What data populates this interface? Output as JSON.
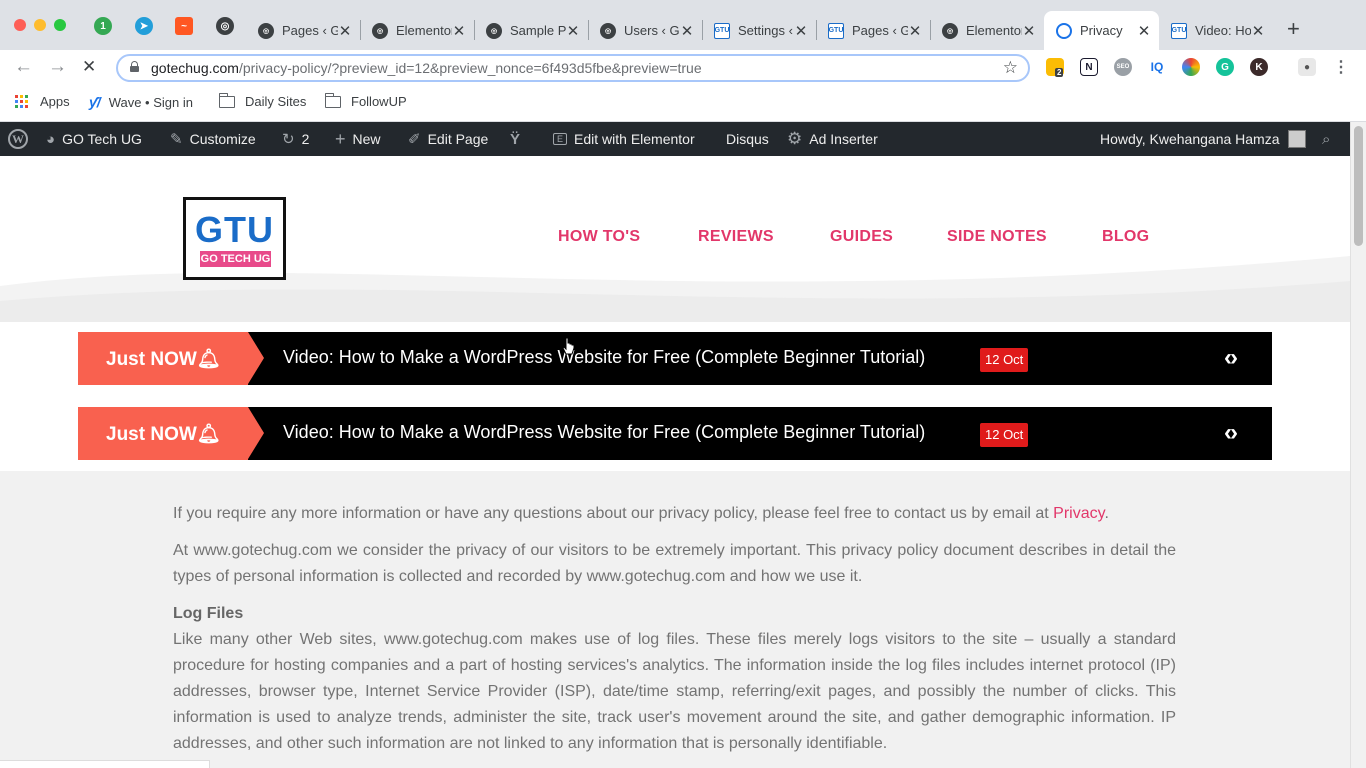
{
  "browser": {
    "tabs": [
      {
        "title": "Pages ‹ GO Tech UG — WordPress",
        "favicon": "globe-icon"
      },
      {
        "title": "Elementor",
        "favicon": "globe-icon"
      },
      {
        "title": "Sample Page",
        "favicon": "globe-icon"
      },
      {
        "title": "Users ‹ GO Tech UG",
        "favicon": "globe-icon"
      },
      {
        "title": "Settings ‹ GO Tech UG",
        "favicon": "gtu-icon"
      },
      {
        "title": "Pages ‹ GO Tech UG",
        "favicon": "gtu-icon"
      },
      {
        "title": "Elementor",
        "favicon": "globe-icon"
      },
      {
        "title": "Privacy",
        "favicon": "wordpress-icon",
        "active": true
      },
      {
        "title": "Video: How to Make a WordPress Website",
        "favicon": "gtu-icon"
      }
    ],
    "url_host": "gotechug.com",
    "url_path": "/privacy-policy/?preview_id=12&preview_nonce=6f493d5fbe&preview=true",
    "bookmarks": [
      {
        "label": "Apps",
        "icon": "apps-grid-icon"
      },
      {
        "label": "Wave • Sign in",
        "icon": "wave-icon"
      },
      {
        "label": "Daily Sites",
        "icon": "folder-icon"
      },
      {
        "label": "FollowUP",
        "icon": "folder-icon"
      }
    ],
    "extension_badge": "2"
  },
  "adminbar": {
    "site_name": "GO Tech UG",
    "customize": "Customize",
    "updates_count": "2",
    "new": "New",
    "edit_page": "Edit Page",
    "edit_elementor": "Edit with Elementor",
    "disqus": "Disqus",
    "ad_inserter": "Ad Inserter",
    "howdy": "Howdy, Kwehangana Hamza"
  },
  "site": {
    "logo_main": "GTU",
    "logo_sub": "GO TECH UG",
    "nav": [
      "HOW TO'S",
      "REVIEWS",
      "GUIDES",
      "SIDE NOTES",
      "BLOG"
    ],
    "tickers": [
      {
        "label": "Just NOW",
        "headline": "Video: How to Make a WordPress Website for Free (Complete Beginner Tutorial)",
        "date": "12 Oct"
      },
      {
        "label": "Just NOW",
        "headline": "Video: How to Make a WordPress Website for Free (Complete Beginner Tutorial)",
        "date": "12 Oct"
      }
    ]
  },
  "content": {
    "p1": "If you require any more information or have any questions about our privacy policy, please feel free to contact us by email at ",
    "p1_link": "Privacy",
    "p1_end": ".",
    "p2": "At www.gotechug.com we consider the privacy of our visitors to be extremely important. This privacy policy document describes in detail the types of personal information is collected and recorded by www.gotechug.com and how we use it.",
    "h_log": "Log Files",
    "p3": "Like many other Web sites, www.gotechug.com makes use of log files. These files merely logs visitors to the site – usually a standard procedure for hosting companies and a part of hosting services's analytics. The information inside the log files includes internet protocol (IP) addresses, browser type, Internet Service Provider (ISP), date/time stamp, referring/exit pages, and possibly the number of clicks. This information is used to analyze trends, administer the site, track user's movement around the site, and gather demographic information. IP addresses, and other such information are not linked to any information that is personally identifiable."
  },
  "colors": {
    "accent_pink": "#e2376a",
    "ticker_orange": "#f9614f",
    "logo_blue": "#1a6cc8",
    "admin_bar": "#23282d"
  }
}
